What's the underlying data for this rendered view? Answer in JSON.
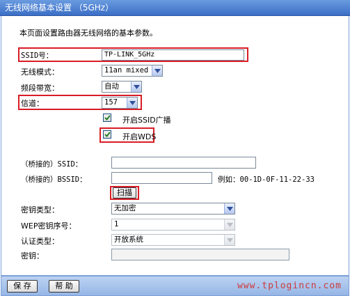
{
  "header": {
    "title": "无线网络基本设置 （5GHz）"
  },
  "intro": "本页面设置路由器无线网络的基本参数。",
  "fields": {
    "ssid": {
      "label": "SSID号：",
      "value": "TP-LINK_5GHz"
    },
    "mode": {
      "label": "无线模式：",
      "value": "11an mixed"
    },
    "bandwidth": {
      "label": "频段带宽：",
      "value": "自动"
    },
    "channel": {
      "label": "信道：",
      "value": "157"
    },
    "ssid_broadcast": {
      "label": "开启SSID广播",
      "checked": true
    },
    "wds": {
      "label": "开启WDS",
      "checked": true
    },
    "bridged_ssid": {
      "label": "（桥接的）SSID：",
      "value": ""
    },
    "bridged_bssid": {
      "label": "（桥接的）BSSID：",
      "value": "",
      "example": "例如：00-1D-0F-11-22-33"
    },
    "scan_button": "扫描",
    "key_type": {
      "label": "密钥类型：",
      "value": "无加密"
    },
    "wep_index": {
      "label": "WEP密钥序号：",
      "value": "1"
    },
    "auth_type": {
      "label": "认证类型：",
      "value": "开放系统"
    },
    "key": {
      "label": "密钥：",
      "value": ""
    }
  },
  "footer": {
    "save_label": "保 存",
    "help_label": "帮 助",
    "watermark": "www.tplogincn.com"
  },
  "colors": {
    "highlight": "#d81c26",
    "title_bar": "#4a7fd2",
    "footer_bar": "#a9c3ec"
  }
}
